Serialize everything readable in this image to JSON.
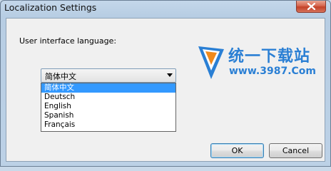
{
  "window": {
    "title": "Localization Settings"
  },
  "form": {
    "language_label": "User interface language:",
    "selected_language": "简体中文",
    "options": [
      "简体中文",
      "Deutsch",
      "English",
      "Spanish",
      "Français"
    ],
    "selected_index": 0
  },
  "buttons": {
    "ok_label": "OK",
    "cancel_label": "Cancel"
  },
  "watermark": {
    "text": "统一下载站",
    "url": "www.3987.Com"
  },
  "colors": {
    "selection": "#3399ff",
    "watermark": "#2a7fd4"
  }
}
